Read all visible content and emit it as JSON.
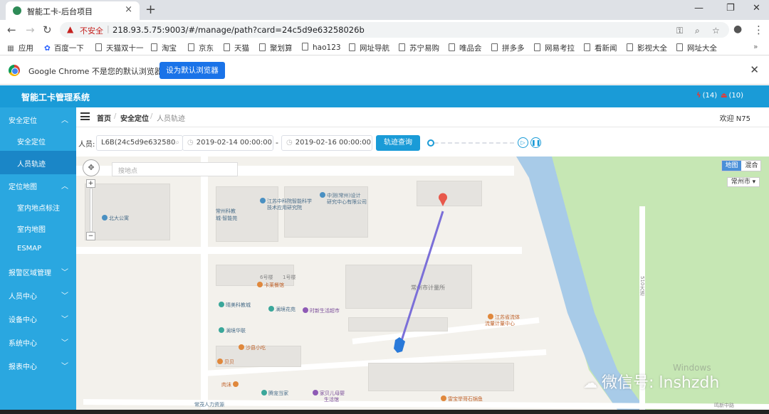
{
  "browser": {
    "tab_title": "智能工卡-后台项目",
    "tab_close": "×",
    "new_tab": "+",
    "win_min": "—",
    "win_max": "❐",
    "win_close": "✕",
    "insecure_label": "不安全",
    "url": "218.93.5.75:9003/#/manage/path?card=24c5d9e63258026b"
  },
  "bookmarks": [
    "应用",
    "百度一下",
    "天猫双十一",
    "淘宝",
    "京东",
    "天猫",
    "聚划算",
    "hao123",
    "网址导航",
    "苏宁易购",
    "唯品会",
    "拼多多",
    "网易考拉",
    "看新闻",
    "影视大全",
    "网址大全"
  ],
  "bookmarks_more": "»",
  "infobar": {
    "message": "Google Chrome 不是您的默认浏览器",
    "button": "设为默认浏览器",
    "close": "✕"
  },
  "app": {
    "title": "智能工卡管理系统",
    "alert1": "(14)",
    "alert2": "(10)",
    "welcome": "欢迎 N75"
  },
  "sidebar": [
    {
      "label": "安全定位",
      "chev": "︿",
      "type": "group"
    },
    {
      "label": "安全定位",
      "type": "sub"
    },
    {
      "label": "人员轨迹",
      "type": "sub",
      "active": true
    },
    {
      "label": "定位地图",
      "chev": "︿",
      "type": "group"
    },
    {
      "label": "室内地点标注",
      "type": "sub"
    },
    {
      "label": "室内地图",
      "type": "sub"
    },
    {
      "label": "ESMAP",
      "type": "sub"
    },
    {
      "label": "报警区域管理",
      "chev": "﹀",
      "type": "group"
    },
    {
      "label": "人员中心",
      "chev": "﹀",
      "type": "group"
    },
    {
      "label": "设备中心",
      "chev": "﹀",
      "type": "group"
    },
    {
      "label": "系统中心",
      "chev": "﹀",
      "type": "group"
    },
    {
      "label": "报表中心",
      "chev": "﹀",
      "type": "group"
    }
  ],
  "breadcrumb": {
    "home": "首页",
    "sep": "/",
    "section": "安全定位",
    "page": "人员轨迹"
  },
  "query": {
    "person_label": "人员:",
    "person_value": "L6B(24c5d9e632580",
    "start": "2019-02-14 00:00:00",
    "dash": "-",
    "end": "2019-02-16 00:00:00",
    "button": "轨迹查询"
  },
  "map": {
    "search_placeholder": "搜地点",
    "type_map": "地图",
    "type_hybrid": "混合",
    "city": "常州市",
    "zoom_in": "+",
    "zoom_out": "−",
    "pois": {
      "beida": "北大公寓",
      "changzhou_kejiao": "常州科教",
      "kejiao2": "城·智能苑",
      "jiangsu_zhongke": "江苏中科院智能科学",
      "jiangsu_zhongke2": "技术应用研究院",
      "zhongce": "中测(常州)设计",
      "zhongce2": "研究中心有限公司",
      "jiliang": "常州市计量所",
      "jiangsu_liuti": "江苏省流体",
      "jiangsu_liuti2": "流量计量中心",
      "qingmei": "晴美科教城",
      "lanjing_garden": "澜境花苑",
      "shidai": "时新生活超市",
      "lanjing_hua": "澜境华联",
      "shaxian": "沙县小吃",
      "gongyu": "6号楼",
      "gongyu2": "1号楼",
      "kameican": "卡莱餐馆",
      "beiqin": "贝贝",
      "rouxian": "肉沫",
      "shengshi": "腾宠当家",
      "jiabei": "家贝儿母婴",
      "jiabei2": "生活馆",
      "hr": "常茂人力资源",
      "yasen": "雷宝举哥石锅鱼",
      "road_510": "510大道",
      "road_bottom": "鸣新中路"
    }
  },
  "watermark": "微信号: lnshzdh",
  "windows_text": "Windows"
}
